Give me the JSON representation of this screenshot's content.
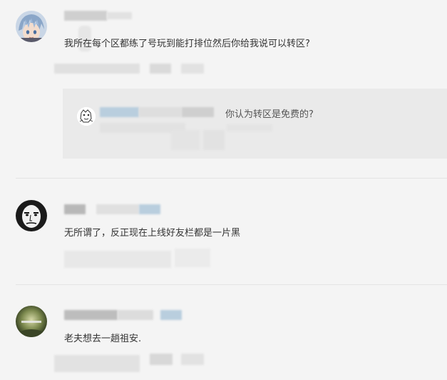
{
  "comments": [
    {
      "text": "我所在每个区都练了号玩到能打排位然后你给我说可以转区?",
      "reply": {
        "text": "你认为转区是免费的?"
      }
    },
    {
      "text": "无所谓了，反正现在上线好友栏都是一片黑"
    },
    {
      "text": "老夫想去一趟祖安."
    }
  ]
}
